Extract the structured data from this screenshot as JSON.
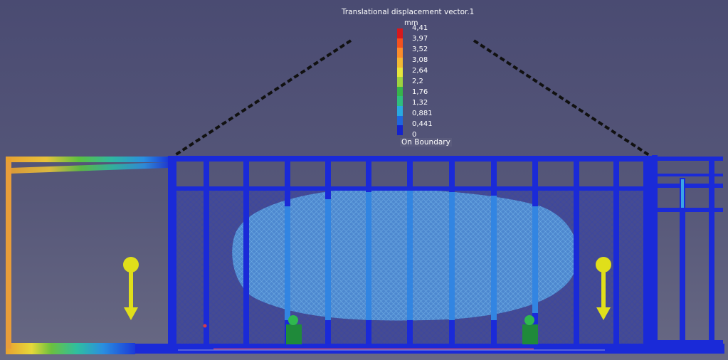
{
  "legend": {
    "title": "Translational displacement vector.1",
    "unit": "mm",
    "ticks": [
      "4,41",
      "3,97",
      "3,52",
      "3,08",
      "2,64",
      "2,2",
      "1,76",
      "1,32",
      "0,881",
      "0,441",
      "0"
    ],
    "colors": [
      "#d7191c",
      "#f4511e",
      "#fb8c2b",
      "#f2b933",
      "#e6e63c",
      "#9ed23f",
      "#37b44a",
      "#2fbd7c",
      "#29a9e0",
      "#1f66dd",
      "#1422cc"
    ],
    "boundary_label": "On Boundary"
  },
  "scene": {
    "colors": {
      "low": "#1a2ad8",
      "mid": "#2e8fe0",
      "blob": "#5aa0dd",
      "high": "#e89d3a",
      "arrow": "#e0df1a",
      "sphere": "#2aa84a",
      "dashed": "#111111"
    },
    "load_arrows": [
      "left-arrow-icon",
      "right-arrow-icon"
    ]
  }
}
